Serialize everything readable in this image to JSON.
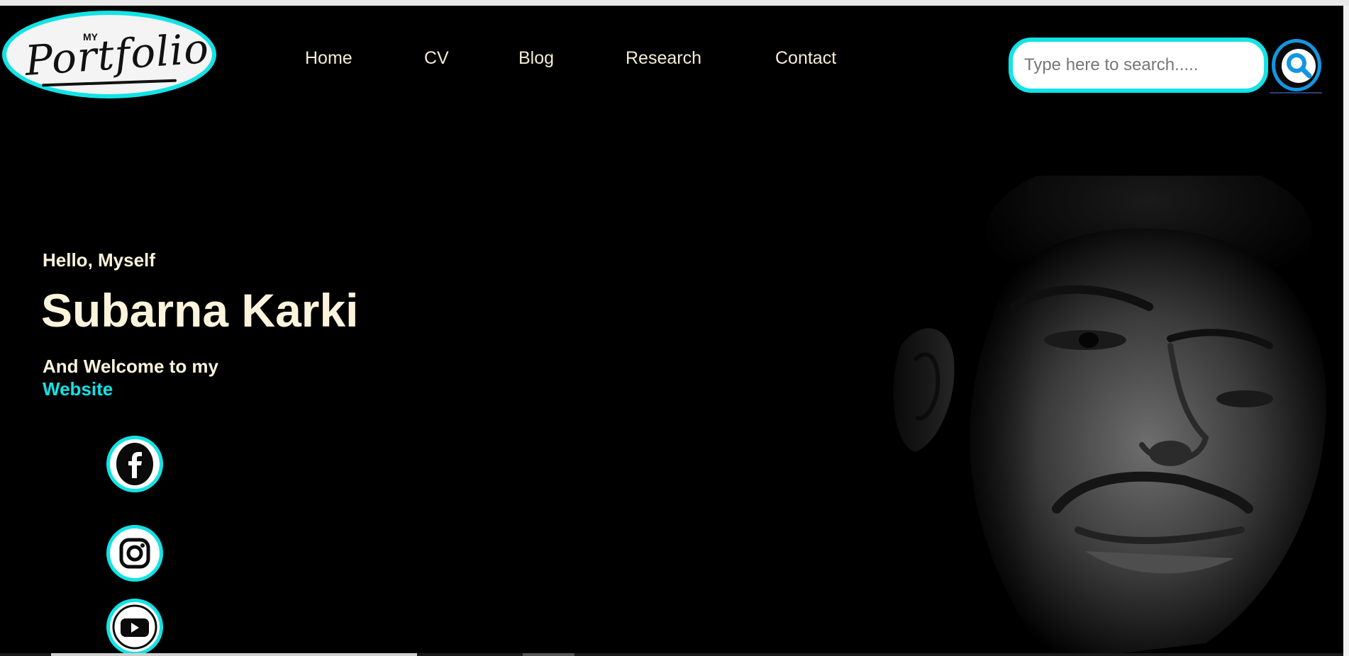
{
  "logo": {
    "small_text": "MY",
    "script_text": "Portfolio"
  },
  "nav": {
    "items": [
      {
        "label": "Home"
      },
      {
        "label": "CV"
      },
      {
        "label": "Blog"
      },
      {
        "label": "Research"
      },
      {
        "label": "Contact"
      }
    ]
  },
  "search": {
    "placeholder": "Type here to search.....",
    "value": ""
  },
  "hero": {
    "greeting": "Hello, Myself",
    "name": "Subarna Karki",
    "welcome": "And Welcome to my",
    "website": "Website"
  },
  "social": {
    "icons": [
      "facebook-icon",
      "instagram-icon",
      "youtube-icon"
    ]
  },
  "colors": {
    "background": "#000000",
    "accent": "#12e3e6",
    "text": "#fbf3dc",
    "search_icon": "#1496e0"
  }
}
